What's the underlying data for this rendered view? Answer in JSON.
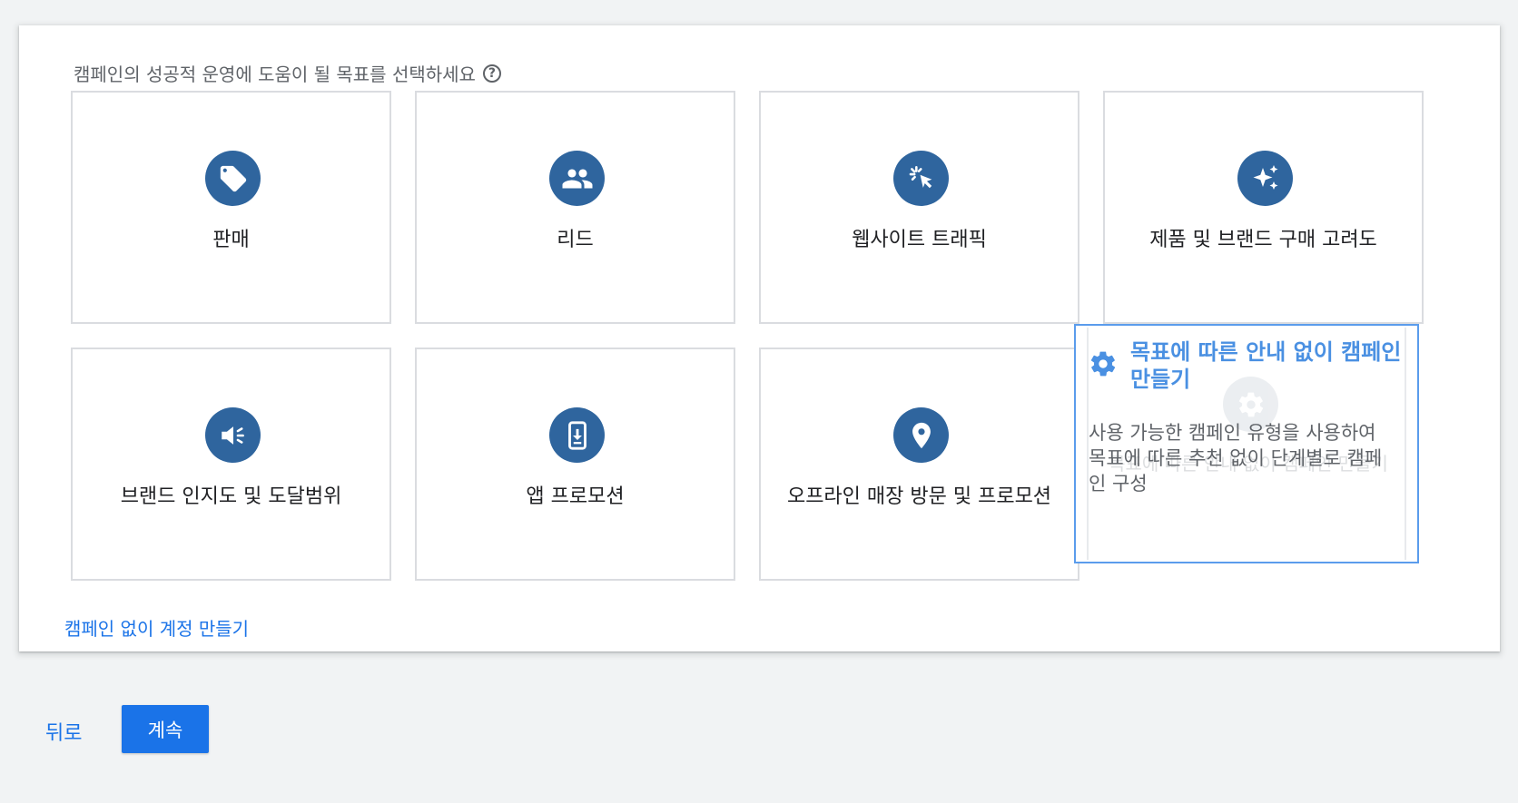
{
  "heading": {
    "text": "캠페인의 성공적 운영에 도움이 될 목표를 선택하세요",
    "help_icon": "help-circle-icon"
  },
  "goals": [
    {
      "label": "판매",
      "icon": "sell-tag-icon"
    },
    {
      "label": "리드",
      "icon": "people-icon"
    },
    {
      "label": "웹사이트 트래픽",
      "icon": "cursor-click-icon"
    },
    {
      "label": "제품 및 브랜드 구매 고려도",
      "icon": "sparkle-icon"
    },
    {
      "label": "브랜드 인지도 및 도달범위",
      "icon": "megaphone-icon"
    },
    {
      "label": "앱 프로모션",
      "icon": "mobile-download-icon"
    },
    {
      "label": "오프라인 매장 방문 및 프로모션",
      "icon": "location-pin-icon"
    }
  ],
  "selected_goal": {
    "title": "목표에 따른 안내 없이 캠페인 만들기",
    "description": "사용 가능한 캠페인 유형을 사용하여 목표에 따른 추천 없이 단계별로 캠페인 구성",
    "icon": "gear-icon"
  },
  "create_account_link": "캠페인 없이 계정 만들기",
  "footer": {
    "back_label": "뒤로",
    "continue_label": "계속"
  },
  "colors": {
    "icon_bg": "#2f659e",
    "accent": "#1a73e8",
    "selected_border": "#5b9cec"
  }
}
